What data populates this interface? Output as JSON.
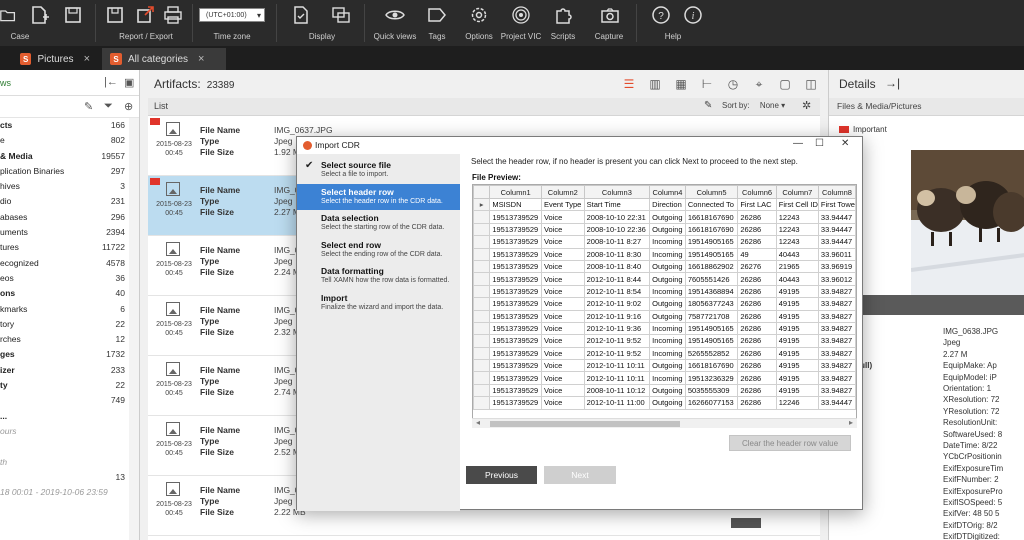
{
  "ribbon": {
    "groups": {
      "case": "Case",
      "report_export": "Report / Export",
      "time_zone": "Time zone",
      "display": "Display",
      "quick_views": "Quick views",
      "tags": "Tags",
      "options": "Options",
      "project_vic": "Project VIC",
      "scripts": "Scripts",
      "capture": "Capture",
      "help": "Help"
    },
    "timezone_value": "(UTC+01:00)"
  },
  "tabs": [
    {
      "label": "Pictures",
      "icon": "s-app-icon",
      "active": false
    },
    {
      "label": "All categories",
      "icon": "s-app-icon",
      "active": true
    }
  ],
  "left_panel": {
    "header": "ws",
    "items": [
      {
        "name": "cts",
        "count": "166",
        "bold": true
      },
      {
        "name": "e",
        "count": "802",
        "bold": false
      },
      {
        "name": "& Media",
        "count": "19557",
        "bold": true
      },
      {
        "name": "plication Binaries",
        "count": "297",
        "bold": false
      },
      {
        "name": "hives",
        "count": "3",
        "bold": false
      },
      {
        "name": "dio",
        "count": "231",
        "bold": false
      },
      {
        "name": "abases",
        "count": "296",
        "bold": false
      },
      {
        "name": "uments",
        "count": "2394",
        "bold": false
      },
      {
        "name": "tures",
        "count": "11722",
        "bold": false
      },
      {
        "name": "ecognized",
        "count": "4578",
        "bold": false
      },
      {
        "name": "eos",
        "count": "36",
        "bold": false
      },
      {
        "name": "ons",
        "count": "40",
        "bold": true
      },
      {
        "name": "kmarks",
        "count": "6",
        "bold": false
      },
      {
        "name": "tory",
        "count": "22",
        "bold": false
      },
      {
        "name": "rches",
        "count": "12",
        "bold": false
      },
      {
        "name": "ges",
        "count": "1732",
        "bold": true
      },
      {
        "name": "izer",
        "count": "233",
        "bold": true
      },
      {
        "name": "ty",
        "count": "22",
        "bold": true
      },
      {
        "name": "",
        "count": "749",
        "bold": false
      },
      {
        "name": "...",
        "count": "",
        "bold": true
      },
      {
        "name": "ours",
        "count": "",
        "bold": false,
        "muted": true
      },
      {
        "name": "",
        "count": "",
        "bold": false
      },
      {
        "name": "th",
        "count": "",
        "bold": false,
        "muted": true
      },
      {
        "name": "",
        "count": "13",
        "bold": false
      },
      {
        "name": "18 00:01 - 2019-10-06 23:59",
        "count": "",
        "bold": false,
        "muted": true
      }
    ]
  },
  "artifacts": {
    "label": "Artifacts:",
    "count": "23389",
    "list_title": "List",
    "sort_label": "Sort by:",
    "sort_value": "None",
    "items": [
      {
        "date": "2015-08-23",
        "time": "00:45",
        "file_name": "IMG_0637.JPG",
        "type": "Jpeg",
        "file_size": "1.92 M"
      },
      {
        "date": "2015-08-23",
        "time": "00:45",
        "file_name": "IMG_0",
        "type": "Jpeg",
        "file_size": "2.27 M"
      },
      {
        "date": "2015-08-23",
        "time": "00:45",
        "file_name": "IMG_0",
        "type": "Jpeg",
        "file_size": "2.24 M"
      },
      {
        "date": "2015-08-23",
        "time": "00:45",
        "file_name": "IMG_0",
        "type": "Jpeg",
        "file_size": "2.32 M"
      },
      {
        "date": "2015-08-23",
        "time": "00:45",
        "file_name": "IMG_0",
        "type": "Jpeg",
        "file_size": "2.74 M"
      },
      {
        "date": "2015-08-23",
        "time": "00:45",
        "file_name": "IMG_0",
        "type": "Jpeg",
        "file_size": "2.52 M"
      },
      {
        "date": "2015-08-23",
        "time": "00:45",
        "file_name": "IMG_0",
        "type": "Jpeg",
        "file_size": "2.22 MB"
      }
    ],
    "labels": {
      "file_name": "File Name",
      "type": "Type",
      "file_size": "File Size"
    }
  },
  "details": {
    "title": "Details",
    "section": "Files & Media/Pictures",
    "tag": "Important",
    "rows": [
      {
        "k": "ame",
        "v": "IMG_0638.JPG"
      },
      {
        "k": "",
        "v": "Jpeg"
      },
      {
        "k": "e",
        "v": "2.27 M"
      },
      {
        "k": "Data (Full)",
        "v": "EquipMake: Ap"
      },
      {
        "k": "",
        "v": "EquipModel: iP"
      },
      {
        "k": "",
        "v": "Orientation: 1"
      },
      {
        "k": "",
        "v": "XResolution: 72"
      },
      {
        "k": "",
        "v": "YResolution: 72"
      },
      {
        "k": "",
        "v": "ResolutionUnit:"
      },
      {
        "k": "",
        "v": "SoftwareUsed: 8"
      },
      {
        "k": "",
        "v": "DateTime: 8/22"
      },
      {
        "k": "",
        "v": "YCbCrPositionin"
      },
      {
        "k": "",
        "v": "ExifExposureTim"
      },
      {
        "k": "",
        "v": "ExifFNumber: 2"
      },
      {
        "k": "",
        "v": "ExifExposurePro"
      },
      {
        "k": "",
        "v": "ExifISOSpeed: 5"
      },
      {
        "k": "",
        "v": "ExifVer: 48 50 5"
      },
      {
        "k": "",
        "v": "ExifDTOrig: 8/2"
      },
      {
        "k": "",
        "v": "ExifDTDigitized:"
      },
      {
        "k": "",
        "v": "ExifCompConfig"
      }
    ]
  },
  "modal": {
    "title": "Import CDR",
    "instruction": "Select the header row, if no header is present you can click Next to proceed to the next step.",
    "file_preview": "File Preview:",
    "steps": [
      {
        "title": "Select source file",
        "desc": "Select a file to import.",
        "done": true,
        "active": false
      },
      {
        "title": "Select header row",
        "desc": "Select the header row in the CDR data.",
        "done": false,
        "active": true
      },
      {
        "title": "Data selection",
        "desc": "Select the starting row of the CDR data.",
        "done": false,
        "active": false
      },
      {
        "title": "Select end row",
        "desc": "Select the ending row of the CDR data.",
        "done": false,
        "active": false
      },
      {
        "title": "Data formatting",
        "desc": "Tell XAMN how the row data is formatted.",
        "done": false,
        "active": false
      },
      {
        "title": "Import",
        "desc": "Finalize the wizard and import the data.",
        "done": false,
        "active": false
      }
    ],
    "columns": [
      "Column1",
      "Column2",
      "Column3",
      "Column4",
      "Column5",
      "Column6",
      "Column7",
      "Column8"
    ],
    "rows": [
      [
        "MSISDN",
        "Event Type",
        "Start Time",
        "Direction",
        "Connected To",
        "First LAC",
        "First Cell ID",
        "First Towe"
      ],
      [
        "19513739529",
        "Voice",
        "2008-10-10 22:31",
        "Outgoing",
        "16618167690",
        "26286",
        "12243",
        "33.94447"
      ],
      [
        "19513739529",
        "Voice",
        "2008-10-10 22:36",
        "Outgoing",
        "16618167690",
        "26286",
        "12243",
        "33.94447"
      ],
      [
        "19513739529",
        "Voice",
        "2008-10-11 8:27",
        "Incoming",
        "19514905165",
        "26286",
        "12243",
        "33.94447"
      ],
      [
        "19513739529",
        "Voice",
        "2008-10-11 8:30",
        "Incoming",
        "19514905165",
        "49",
        "40443",
        "33.96011"
      ],
      [
        "19513739529",
        "Voice",
        "2008-10-11 8:40",
        "Outgoing",
        "16618862902",
        "26276",
        "21965",
        "33.96919"
      ],
      [
        "19513739529",
        "Voice",
        "2012-10-11 8:44",
        "Outgoing",
        "7605551426",
        "26286",
        "40443",
        "33.96012"
      ],
      [
        "19513739529",
        "Voice",
        "2012-10-11 8:54",
        "Incoming",
        "19514368894",
        "26286",
        "49195",
        "33.94827"
      ],
      [
        "19513739529",
        "Voice",
        "2012-10-11 9:02",
        "Outgoing",
        "18056377243",
        "26286",
        "49195",
        "33.94827"
      ],
      [
        "19513739529",
        "Voice",
        "2012-10-11 9:16",
        "Outgoing",
        "7587721708",
        "26286",
        "49195",
        "33.94827"
      ],
      [
        "19513739529",
        "Voice",
        "2012-10-11 9:36",
        "Incoming",
        "19514905165",
        "26286",
        "49195",
        "33.94827"
      ],
      [
        "19513739529",
        "Voice",
        "2012-10-11 9:52",
        "Incoming",
        "19514905165",
        "26286",
        "49195",
        "33.94827"
      ],
      [
        "19513739529",
        "Voice",
        "2012-10-11 9:52",
        "Incoming",
        "5265552852",
        "26286",
        "49195",
        "33.94827"
      ],
      [
        "19513739529",
        "Voice",
        "2012-10-11 10:11",
        "Outgoing",
        "16618167690",
        "26286",
        "49195",
        "33.94827"
      ],
      [
        "19513739529",
        "Voice",
        "2012-10-11 10:11",
        "Incoming",
        "19513236329",
        "26286",
        "49195",
        "33.94827"
      ],
      [
        "19513739529",
        "Voice",
        "2008-10-11 10:12",
        "Outgoing",
        "5035555309",
        "26286",
        "49195",
        "33.94827"
      ],
      [
        "19513739529",
        "Voice",
        "2012-10-11 11:00",
        "Outgoing",
        "16266077153",
        "26286",
        "12246",
        "33.94447"
      ]
    ],
    "clear_button": "Clear the header row value",
    "previous_button": "Previous",
    "next_button": "Next"
  }
}
